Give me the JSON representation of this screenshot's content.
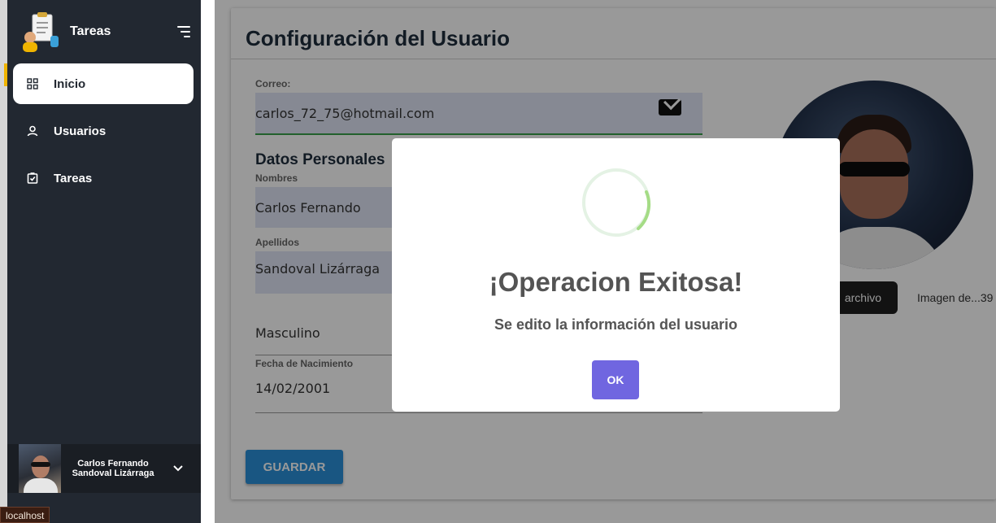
{
  "sidebar": {
    "brand_title": "Tareas",
    "items": [
      {
        "label": "Inicio",
        "icon": "grid-icon",
        "active": true
      },
      {
        "label": "Usuarios",
        "icon": "user-icon",
        "active": false
      },
      {
        "label": "Tareas",
        "icon": "clipboard-check-icon",
        "active": false
      }
    ],
    "profile_name": "Carlos Fernando Sandoval Lizárraga"
  },
  "status_bar": {
    "host": "localhost"
  },
  "page": {
    "title": "Configuración del Usuario",
    "email_label": "Correo:",
    "email_value": "carlos_72_75@hotmail.com",
    "section_title": "Datos Personales",
    "nombres_label": "Nombres",
    "nombres_value": "Carlos Fernando",
    "apellidos_label": "Apellidos",
    "apellidos_value": "Sandoval Lizárraga",
    "genero_value": "Masculino",
    "fecha_label": "Fecha de Nacimiento",
    "fecha_value": "14/02/2001",
    "file_button": "archivo",
    "file_name": "Imagen de...39",
    "save_button": "GUARDAR"
  },
  "modal": {
    "title": "¡Operacion Exitosa!",
    "message": "Se edito la información del usuario",
    "ok_label": "OK"
  },
  "colors": {
    "sidebar_bg": "#222831",
    "accent_green": "#3aa04a",
    "save_blue": "#2b8fd9",
    "ok_purple": "#7066e0"
  }
}
